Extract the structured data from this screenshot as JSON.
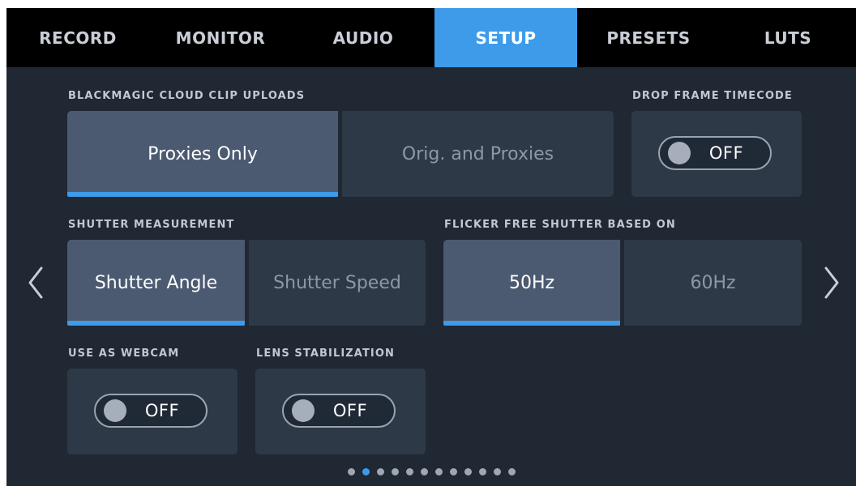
{
  "tabs": [
    {
      "label": "RECORD",
      "active": false
    },
    {
      "label": "MONITOR",
      "active": false
    },
    {
      "label": "AUDIO",
      "active": false
    },
    {
      "label": "SETUP",
      "active": true
    },
    {
      "label": "PRESETS",
      "active": false
    },
    {
      "label": "LUTS",
      "active": false
    }
  ],
  "cloud_uploads": {
    "label": "BLACKMAGIC CLOUD CLIP UPLOADS",
    "options": [
      "Proxies Only",
      "Orig. and Proxies"
    ],
    "selected": "Proxies Only"
  },
  "drop_frame_timecode": {
    "label": "DROP FRAME TIMECODE",
    "state": "OFF"
  },
  "shutter_measurement": {
    "label": "SHUTTER MEASUREMENT",
    "options": [
      "Shutter Angle",
      "Shutter Speed"
    ],
    "selected": "Shutter Angle"
  },
  "flicker_free": {
    "label": "FLICKER FREE SHUTTER BASED ON",
    "options": [
      "50Hz",
      "60Hz"
    ],
    "selected": "50Hz"
  },
  "use_as_webcam": {
    "label": "USE AS WEBCAM",
    "state": "OFF"
  },
  "lens_stabilization": {
    "label": "LENS STABILIZATION",
    "state": "OFF"
  },
  "pagination": {
    "total_pages": 12,
    "current_page": 2
  },
  "navigation": {
    "prev_icon": "chevron-left-icon",
    "next_icon": "chevron-right-icon"
  },
  "colors": {
    "accent": "#3d9bea",
    "background": "#1f2833",
    "button": "#2e3948",
    "button_selected": "#4b5a71",
    "tabbar": "#000000"
  }
}
